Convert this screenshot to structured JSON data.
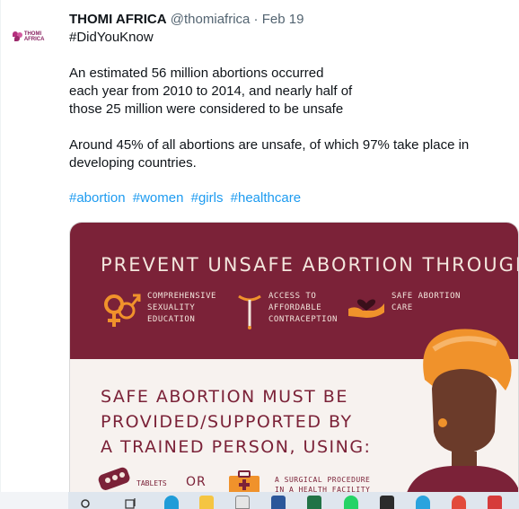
{
  "account": {
    "logo_text": "THOMI AFRICA"
  },
  "tweet": {
    "name": "THOMI AFRICA",
    "handle": "@thomiafrica",
    "separator": "·",
    "date": "Feb 19",
    "hashtag_top": "#DidYouKnow",
    "para1_line1": "An estimated 56 million abortions occurred",
    "para1_line2": "each year from 2010 to 2014, and nearly half of",
    "para1_line3": "those 25 million were considered to be unsafe",
    "para2_line1": "Around 45% of all abortions are unsafe, of which 97% take place in",
    "para2_line2": "developing countries.",
    "tags": [
      "#abortion",
      "#women",
      "#girls",
      "#healthcare"
    ]
  },
  "infographic": {
    "headline": "PREVENT UNSAFE ABORTION THROUGH:",
    "item1": [
      "COMPREHENSIVE",
      "SEXUALITY",
      "EDUCATION"
    ],
    "item2": [
      "ACCESS TO",
      "AFFORDABLE",
      "CONTRACEPTION"
    ],
    "item3": [
      "SAFE ABORTION",
      "CARE"
    ],
    "safe_line1": "SAFE ABORTION MUST BE",
    "safe_line2": "PROVIDED/SUPPORTED BY",
    "safe_line3": "A TRAINED PERSON, USING:",
    "tablets": "TABLETS",
    "or": "OR",
    "surgical_line1": "A SURGICAL PROCEDURE",
    "surgical_line2": "IN A HEALTH FACILITY",
    "colors": {
      "maroon": "#7b2238",
      "cream": "#f3e6dd",
      "orange": "#f0922b",
      "skin": "#6b3b2a"
    }
  },
  "taskbar": {
    "icons": [
      "search-icon",
      "task-view-icon",
      "edge-icon",
      "file-explorer-icon",
      "store-icon",
      "word-icon",
      "excel-icon",
      "whatsapp-icon",
      "app-icon",
      "telegram-icon",
      "chrome-icon",
      "snipping-icon"
    ]
  }
}
